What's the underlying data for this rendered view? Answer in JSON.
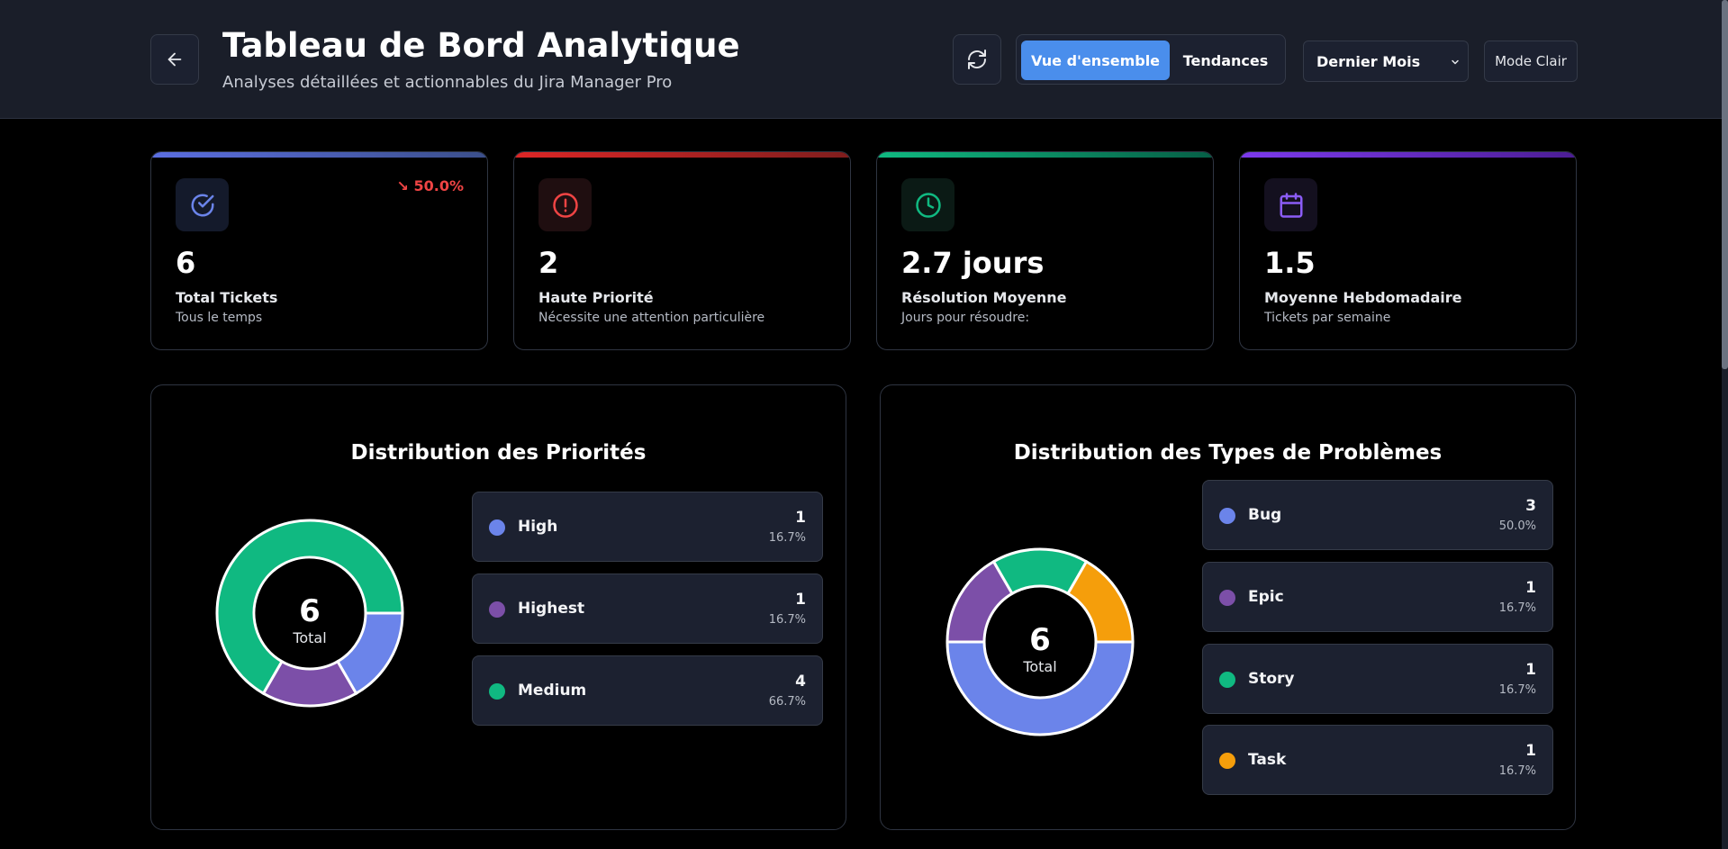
{
  "header": {
    "title": "Tableau de Bord Analytique",
    "subtitle": "Analyses détaillées et actionnables du Jira Manager Pro",
    "tabs": [
      {
        "label": "Vue d'ensemble",
        "active": true
      },
      {
        "label": "Tendances",
        "active": false
      }
    ],
    "period_select": {
      "value": "Dernier Mois"
    },
    "theme_toggle_label": "Mode Clair",
    "icons": {
      "back": "arrow-left-icon",
      "refresh": "refresh-icon",
      "select": "chevron-down-icon"
    }
  },
  "stats": [
    {
      "value": "6",
      "label": "Total Tickets",
      "sub": "Tous le temps",
      "trend": "↘ 50.0%",
      "color": "#5b6ee1",
      "icon": "check-circle-icon"
    },
    {
      "value": "2",
      "label": "Haute Priorité",
      "sub": "Nécessite une attention particulière",
      "color": "#ef4444",
      "icon": "alert-circle-icon"
    },
    {
      "value": "2.7 jours",
      "label": "Résolution Moyenne",
      "sub": "Jours pour résoudre:",
      "color": "#10b981",
      "icon": "clock-icon"
    },
    {
      "value": "1.5",
      "label": "Moyenne Hebdomadaire",
      "sub": "Tickets par semaine",
      "color": "#8b5cf6",
      "icon": "calendar-icon"
    }
  ],
  "colors": {
    "blue": "#6b84ea",
    "purple": "#7c4fa8",
    "green": "#10b981",
    "orange": "#f59e0b",
    "accent": "#4a8eec"
  },
  "chart_data": [
    {
      "type": "pie",
      "title": "Distribution des Priorités",
      "center_value": "6",
      "center_label": "Total",
      "slices": [
        {
          "label": "High",
          "value": 1,
          "percent": "16.7%",
          "color": "#6b84ea"
        },
        {
          "label": "Highest",
          "value": 1,
          "percent": "16.7%",
          "color": "#7c4fa8"
        },
        {
          "label": "Medium",
          "value": 4,
          "percent": "66.7%",
          "color": "#10b981"
        }
      ]
    },
    {
      "type": "pie",
      "title": "Distribution des Types de Problèmes",
      "center_value": "6",
      "center_label": "Total",
      "slices": [
        {
          "label": "Bug",
          "value": 3,
          "percent": "50.0%",
          "color": "#6b84ea"
        },
        {
          "label": "Epic",
          "value": 1,
          "percent": "16.7%",
          "color": "#7c4fa8"
        },
        {
          "label": "Story",
          "value": 1,
          "percent": "16.7%",
          "color": "#10b981"
        },
        {
          "label": "Task",
          "value": 1,
          "percent": "16.7%",
          "color": "#f59e0b"
        }
      ]
    }
  ]
}
